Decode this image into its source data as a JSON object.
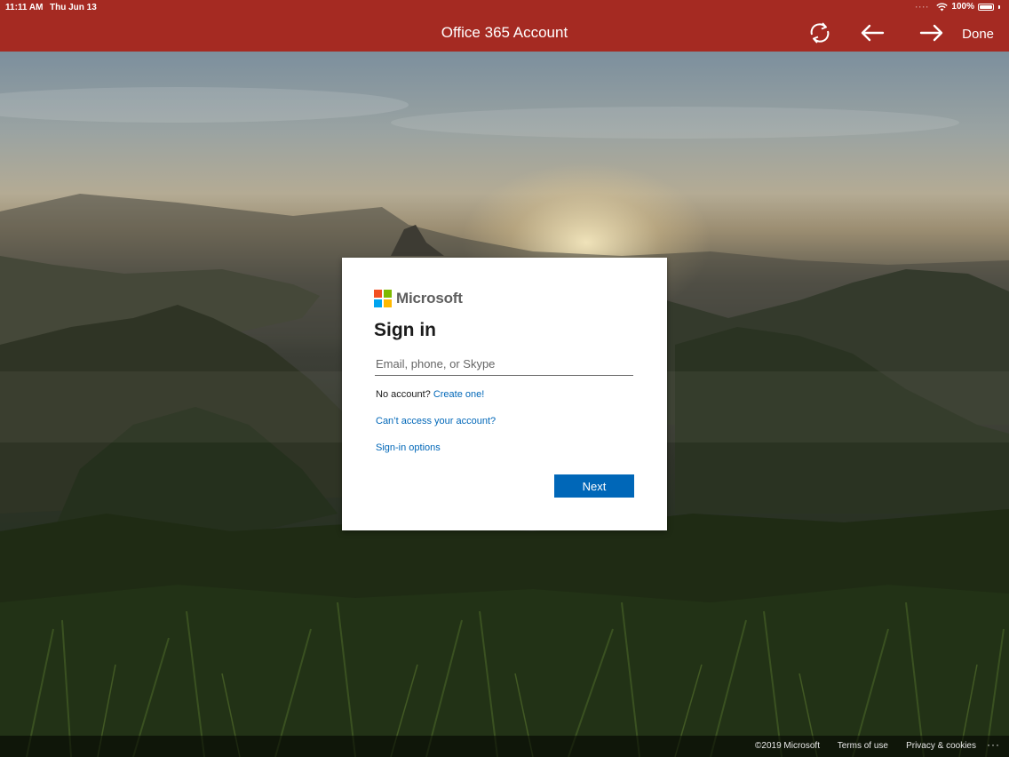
{
  "status_bar": {
    "time": "11:11 AM",
    "date": "Thu Jun 13",
    "battery": "100%",
    "icons": [
      "cellular-dots-icon",
      "wifi-icon",
      "battery-icon"
    ]
  },
  "nav": {
    "title": "Office 365 Account",
    "refresh_icon": "refresh-icon",
    "back_icon": "back-arrow-icon",
    "forward_icon": "forward-arrow-icon",
    "done_label": "Done",
    "bar_color": "#a52a22"
  },
  "card": {
    "brand": "Microsoft",
    "heading": "Sign in",
    "email_placeholder": "Email, phone, or Skype",
    "email_value": "",
    "no_account_text": "No account?",
    "create_link": "Create one!",
    "cant_access_link": "Can’t access your account?",
    "signin_options_link": "Sign-in options",
    "next_label": "Next",
    "accent_color": "#0067b8"
  },
  "footer": {
    "copyright": "©2019 Microsoft",
    "terms": "Terms of use",
    "privacy": "Privacy & cookies",
    "more": "···"
  }
}
